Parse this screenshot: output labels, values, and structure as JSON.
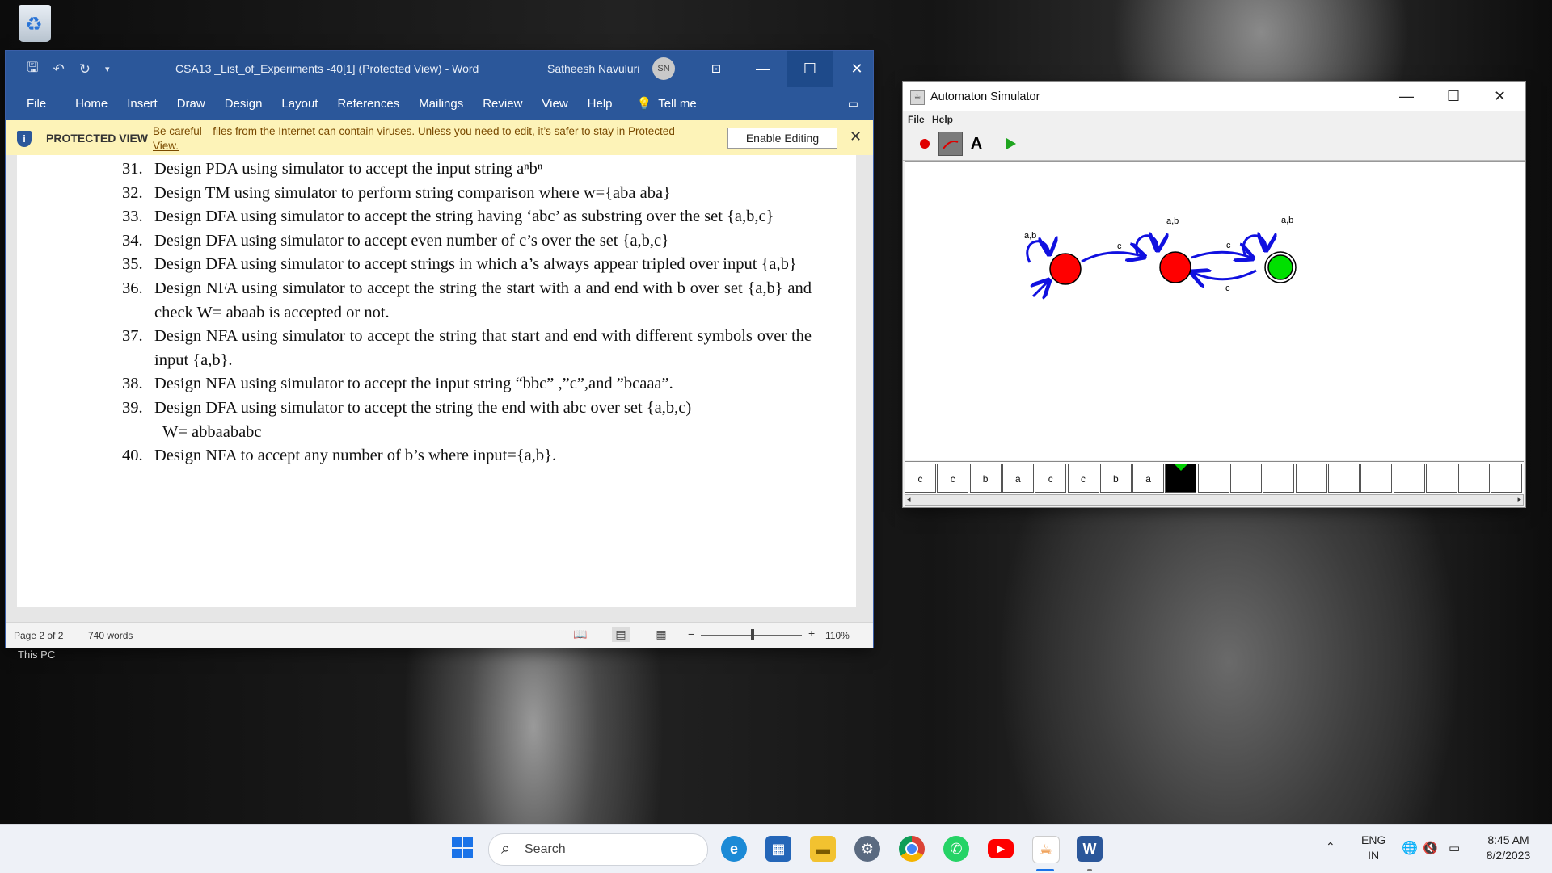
{
  "desktop": {
    "recycle_bin_icon": "recycle-bin-icon",
    "this_pc_label": "This PC"
  },
  "word": {
    "doc_title": "CSA13 _List_of_Experiments -40[1] (Protected View)  -  Word",
    "user_name": "Satheesh Navuluri",
    "user_initials": "SN",
    "ribbon_tabs": [
      "File",
      "Home",
      "Insert",
      "Draw",
      "Design",
      "Layout",
      "References",
      "Mailings",
      "Review",
      "View",
      "Help"
    ],
    "tell_me": "Tell me",
    "protected": {
      "label": "PROTECTED VIEW",
      "message": "Be careful—files from the Internet can contain viruses. Unless you need to edit, it’s safer to stay in Protected View.",
      "enable_button": "Enable Editing"
    },
    "items": [
      {
        "num": "31.",
        "text": "Design PDA using simulator to accept the input string  aⁿbⁿ"
      },
      {
        "num": "32.",
        "text": "Design TM using simulator to perform string comparison where w={aba aba}"
      },
      {
        "num": "33.",
        "text": "Design DFA using simulator to accept the string having ‘abc’ as substring over the set {a,b,c}"
      },
      {
        "num": "34.",
        "text": "Design DFA  using simulator to  accept even number of c’s over the set {a,b,c}"
      },
      {
        "num": "35.",
        "text": "Design DFA  using simulator to  accept strings in which a’s always appear tripled over input {a,b}"
      },
      {
        "num": "36.",
        "text": "Design NFA using simulator to accept the string the start with a and end with b over set {a,b} and check W=  abaab is accepted or not."
      },
      {
        "num": "37.",
        "text": "Design NFA using simulator to accept the string that start and end with different symbols over the input {a,b}."
      },
      {
        "num": "38.",
        "text": "Design NFA  using simulator to accept the input string “bbc” ,”c”,and ”bcaaa”."
      },
      {
        "num": "39.",
        "text": "Design DFA using simulator to accept the string the end with abc over set {a,b,c)"
      },
      {
        "num": "",
        "text": "W=  abbaababc"
      },
      {
        "num": "40.",
        "text": "Design NFA to accept any number of b’s where input={a,b}."
      }
    ],
    "status": {
      "page": "Page 2 of 2",
      "words": "740 words",
      "zoom": "110%"
    }
  },
  "automaton": {
    "title": "Automaton Simulator",
    "menu": [
      "File",
      "Help"
    ],
    "tools": [
      "state-tool-icon",
      "transition-tool-icon",
      "label-tool-icon",
      "run-icon"
    ],
    "transition_labels": {
      "loop1": "a,b",
      "loop2": "a,b",
      "loop3": "a,b",
      "e12": "c",
      "e23": "c",
      "e32": "c"
    },
    "state_colors": {
      "q0": "#ff0000",
      "q1": "#ff0000",
      "q2": "#00e000"
    },
    "tape": [
      "c",
      "c",
      "b",
      "a",
      "c",
      "c",
      "b",
      "a",
      "",
      "",
      "",
      "",
      "",
      "",
      "",
      "",
      "",
      "",
      "",
      ""
    ],
    "head_index": 8
  },
  "taskbar": {
    "search_placeholder": "Search",
    "apps": [
      "windows-start-icon",
      "edge-icon",
      "microsoft-store-icon",
      "file-explorer-icon",
      "settings-icon",
      "chrome-icon",
      "whatsapp-icon",
      "youtube-icon",
      "java-icon",
      "word-icon"
    ],
    "lang_top": "ENG",
    "lang_bottom": "IN",
    "time": "8:45 AM",
    "date": "8/2/2023"
  }
}
